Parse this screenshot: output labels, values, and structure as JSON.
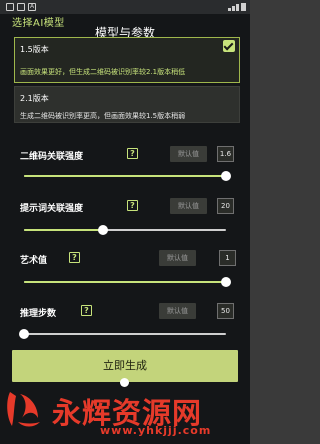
{
  "status_bar": {
    "icons": [
      "square-icon",
      "square-icon",
      "A-icon",
      "signal-icon",
      "battery-icon"
    ],
    "notify_letter": "A"
  },
  "top_title": "选择AI模型",
  "header_title": "模型与参数",
  "models": [
    {
      "name": "1.5版本",
      "desc": "画面效果更好，但生成二维码被识别率较2.1版本稍低",
      "selected": true
    },
    {
      "name": "2.1版本",
      "desc": "生成二维码被识别率更高，但画面效果较1.5版本稍弱",
      "selected": false
    }
  ],
  "params": [
    {
      "label": "二维码关联强度",
      "help": "?",
      "default_label": "默认值",
      "value": "1.6",
      "level": 1.0
    },
    {
      "label": "提示词关联强度",
      "help": "?",
      "default_label": "默认值",
      "value": "20",
      "level": 0.39
    },
    {
      "label": "艺术值",
      "help": "?",
      "default_label": "默认值",
      "value": "1",
      "level": 1.0
    },
    {
      "label": "推理步数",
      "help": "?",
      "default_label": "默认值",
      "value": "50",
      "level": 0.0
    }
  ],
  "generate_button": "立即生成",
  "watermark": {
    "brand": "永辉资源网",
    "url": "www.yhkjjj.com"
  },
  "colors": {
    "accent": "#c7e37b",
    "background": "#141618",
    "button": "#c3d47b",
    "watermark": "#e63a2a"
  }
}
